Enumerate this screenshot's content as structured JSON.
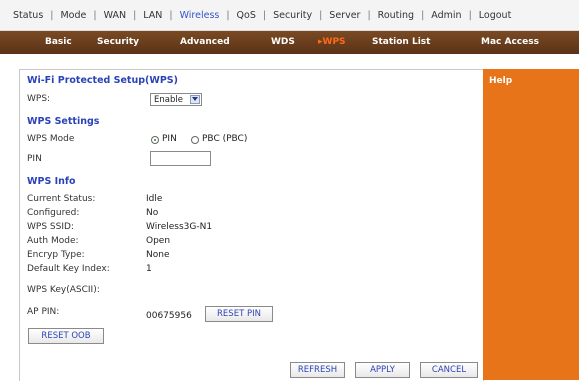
{
  "topnav": {
    "items": [
      {
        "label": "Status",
        "active": false
      },
      {
        "label": "Mode",
        "active": false
      },
      {
        "label": "WAN",
        "active": false
      },
      {
        "label": "LAN",
        "active": false
      },
      {
        "label": "Wireless",
        "active": true
      },
      {
        "label": "QoS",
        "active": false
      },
      {
        "label": "Security",
        "active": false
      },
      {
        "label": "Server",
        "active": false
      },
      {
        "label": "Routing",
        "active": false
      },
      {
        "label": "Admin",
        "active": false
      },
      {
        "label": "Logout",
        "active": false
      }
    ]
  },
  "subnav": {
    "tabs": [
      {
        "label": "Basic"
      },
      {
        "label": "Security"
      },
      {
        "label": "Advanced"
      },
      {
        "label": "WDS"
      },
      {
        "label": "▸WPS"
      },
      {
        "label": "Station List"
      },
      {
        "label": "Mac Access"
      }
    ],
    "active_color": "#ff6a1a"
  },
  "help": {
    "title": "Help"
  },
  "wps": {
    "section_title": "Wi-Fi Protected Setup(WPS)",
    "wps_label": "WPS:",
    "wps_value": "Enable",
    "settings_title": "WPS Settings",
    "mode_label": "WPS Mode",
    "mode_option_pin": "PIN",
    "mode_option_pbc": "PBC (PBC)",
    "mode_selected": "PIN",
    "pin_label": "PIN",
    "pin_value": "",
    "info_title": "WPS Info",
    "info": [
      {
        "label": "Current Status:",
        "value": "Idle"
      },
      {
        "label": "Configured:",
        "value": "No"
      },
      {
        "label": "WPS SSID:",
        "value": "Wireless3G-N1"
      },
      {
        "label": "Auth Mode:",
        "value": "Open"
      },
      {
        "label": "Encryp Type:",
        "value": "None"
      },
      {
        "label": "Default Key Index:",
        "value": "1"
      }
    ],
    "key_label": "WPS Key(ASCII):",
    "ap_pin_label": "AP PIN:",
    "ap_pin_value": "00675956",
    "reset_pin_label": "RESET PIN",
    "reset_oob_label": "RESET OOB"
  },
  "actions": {
    "refresh_label": "REFRESH",
    "apply_label": "APPLY",
    "cancel_label": "CANCEL"
  },
  "colors": {
    "accent_blue": "#2a43b8",
    "help_orange": "#e8741a",
    "subnav_brown": "#5a3216"
  }
}
